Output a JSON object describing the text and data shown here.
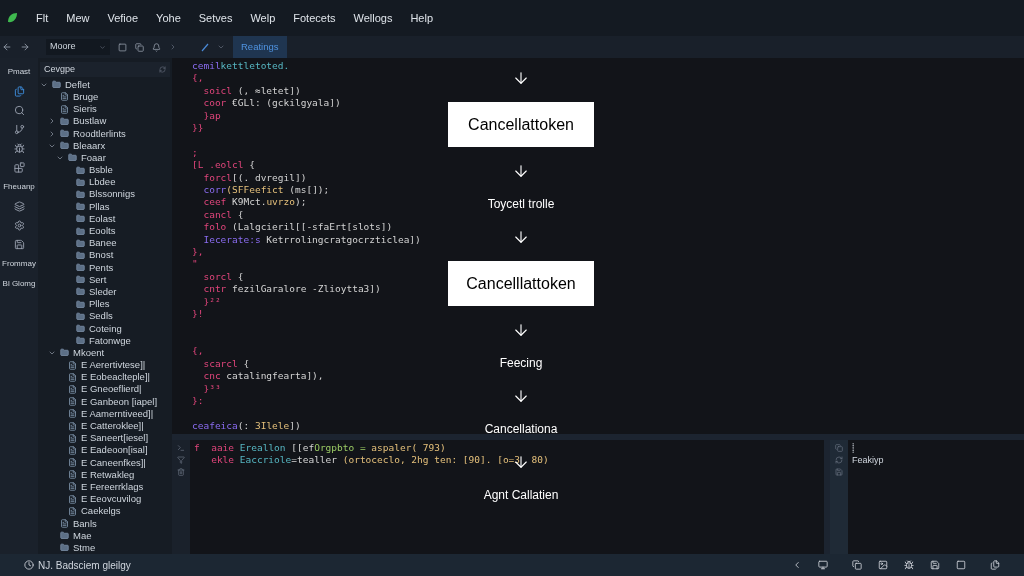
{
  "menu_bar": {
    "items": [
      "Flt",
      "Mew",
      "Vefioe",
      "Yohe",
      "Setves",
      "Welp",
      "Fotecets",
      "Wellogs",
      "Help"
    ]
  },
  "toolbar": {
    "dropdown": "Moore",
    "tabs": [
      {
        "label": "Reatings",
        "selected": true
      }
    ]
  },
  "activity_bar": {
    "labels": [
      "Pmast",
      "Fheuanp",
      "Frommay",
      "Bl Glomg"
    ]
  },
  "sidebar": {
    "header": "Cevgpe",
    "tree": [
      {
        "label": "Deflet",
        "kind": "folder",
        "expanded": true,
        "children": [
          {
            "label": "Bruge",
            "kind": "file"
          },
          {
            "label": "Sieris",
            "kind": "file"
          },
          {
            "label": "Bustlaw",
            "kind": "folder",
            "expanded": false
          },
          {
            "label": "Roodtlerlints",
            "kind": "folder",
            "expanded": false
          },
          {
            "label": "Bleaarx",
            "kind": "folder",
            "expanded": true,
            "children": [
              {
                "label": "Foaar",
                "kind": "folder",
                "expanded": true,
                "children": [
                  {
                    "label": "Bsble",
                    "kind": "folder"
                  },
                  {
                    "label": "Lbdee",
                    "kind": "folder"
                  },
                  {
                    "label": "Blssonnigs",
                    "kind": "folder"
                  },
                  {
                    "label": "Pllas",
                    "kind": "folder"
                  },
                  {
                    "label": "Eolast",
                    "kind": "folder"
                  },
                  {
                    "label": "Eoolts",
                    "kind": "folder"
                  },
                  {
                    "label": "Banee",
                    "kind": "folder"
                  },
                  {
                    "label": "Bnost",
                    "kind": "folder"
                  },
                  {
                    "label": "Pents",
                    "kind": "folder"
                  },
                  {
                    "label": "Sert",
                    "kind": "folder"
                  },
                  {
                    "label": "Sleder",
                    "kind": "folder"
                  },
                  {
                    "label": "Plles",
                    "kind": "folder"
                  },
                  {
                    "label": "Sedls",
                    "kind": "folder"
                  },
                  {
                    "label": "Coteing",
                    "kind": "folder"
                  },
                  {
                    "label": "Fatonwge",
                    "kind": "folder"
                  }
                ]
              }
            ]
          },
          {
            "label": "Mkoent",
            "kind": "folder",
            "expanded": true,
            "children": [
              {
                "label": "E Aerertivtese]|",
                "kind": "file"
              },
              {
                "label": "E Eobeaclteple]|",
                "kind": "file"
              },
              {
                "label": "E Gneoeflierd|",
                "kind": "file"
              },
              {
                "label": "E Ganbeon [iapel]",
                "kind": "file"
              },
              {
                "label": "E Aamerntiveed]|",
                "kind": "file"
              },
              {
                "label": "E Catteroklee]|",
                "kind": "file"
              },
              {
                "label": "E Saneert[iesel]",
                "kind": "file"
              },
              {
                "label": "E Eadeoon[isal]",
                "kind": "file"
              },
              {
                "label": "E Caneenfkes]|",
                "kind": "file"
              },
              {
                "label": "E Retwakleg",
                "kind": "file"
              },
              {
                "label": "E Fereerrklags",
                "kind": "file"
              },
              {
                "label": "E Eeovcuvilog",
                "kind": "file"
              },
              {
                "label": "Caekelgs",
                "kind": "file"
              }
            ]
          },
          {
            "label": "Banls",
            "kind": "file"
          },
          {
            "label": "Mae",
            "kind": "folder"
          },
          {
            "label": "Stme",
            "kind": "folder"
          }
        ]
      }
    ]
  },
  "editor": {
    "lines": [
      {
        "kind": "code",
        "segments": [
          {
            "kind": "type",
            "text": "cemil"
          },
          {
            "kind": "func",
            "text": "kettletoted."
          }
        ]
      },
      {
        "kind": "code",
        "segments": [
          {
            "kind": "keyword",
            "text": "{,"
          }
        ]
      },
      {
        "kind": "code",
        "segments": [
          {
            "kind": "keyword",
            "text": "  soicl"
          },
          {
            "kind": "plain",
            "text": " (, ≈letet])"
          }
        ]
      },
      {
        "kind": "code",
        "segments": [
          {
            "kind": "keyword",
            "text": "  coor"
          },
          {
            "kind": "plain",
            "text": " €GLl: (gckilgyala])"
          }
        ]
      },
      {
        "kind": "code",
        "segments": [
          {
            "kind": "keyword",
            "text": "  }ap"
          }
        ]
      },
      {
        "kind": "code",
        "segments": [
          {
            "kind": "keyword",
            "text": "}}"
          }
        ]
      },
      {
        "kind": "blank"
      },
      {
        "kind": "code",
        "segments": [
          {
            "kind": "keyword",
            "text": ";"
          }
        ]
      },
      {
        "kind": "code",
        "segments": [
          {
            "kind": "keyword",
            "text": "[L .eolcl"
          },
          {
            "kind": "plain",
            "text": " {"
          }
        ]
      },
      {
        "kind": "code",
        "segments": [
          {
            "kind": "keyword",
            "text": "  forcl"
          },
          {
            "kind": "plain",
            "text": "[(. dvregil])"
          }
        ]
      },
      {
        "kind": "code",
        "segments": [
          {
            "kind": "type",
            "text": "  corr"
          },
          {
            "kind": "string",
            "text": "(SFFeefict"
          },
          {
            "kind": "plain",
            "text": " (ms[]);"
          }
        ]
      },
      {
        "kind": "code",
        "segments": [
          {
            "kind": "keyword",
            "text": "  ceef"
          },
          {
            "kind": "plain",
            "text": " K9Mct."
          },
          {
            "kind": "string",
            "text": "uvrzo"
          },
          {
            "kind": "plain",
            "text": ");"
          }
        ]
      },
      {
        "kind": "code",
        "segments": [
          {
            "kind": "keyword",
            "text": "  cancl"
          },
          {
            "kind": "plain",
            "text": " {"
          }
        ]
      },
      {
        "kind": "code",
        "segments": [
          {
            "kind": "keyword",
            "text": "  folo"
          },
          {
            "kind": "plain",
            "text": " (Lalgcieril[[-sfaErt[slots])"
          }
        ]
      },
      {
        "kind": "code",
        "segments": [
          {
            "kind": "type",
            "text": "  Iecerate:s"
          },
          {
            "kind": "plain",
            "text": " Ketrrolingcratgocrzticlea])"
          }
        ]
      },
      {
        "kind": "code",
        "segments": [
          {
            "kind": "keyword",
            "text": "},"
          }
        ]
      },
      {
        "kind": "code",
        "segments": [
          {
            "kind": "keyword",
            "text": "\""
          }
        ]
      },
      {
        "kind": "code",
        "segments": [
          {
            "kind": "keyword",
            "text": "  sorcl"
          },
          {
            "kind": "plain",
            "text": " {"
          }
        ]
      },
      {
        "kind": "code",
        "segments": [
          {
            "kind": "keyword",
            "text": "  cntr"
          },
          {
            "kind": "plain",
            "text": " fezilGaralore -Zlioytta3])"
          }
        ]
      },
      {
        "kind": "code",
        "segments": [
          {
            "kind": "keyword",
            "text": "  }²²"
          }
        ]
      },
      {
        "kind": "code",
        "segments": [
          {
            "kind": "keyword",
            "text": "}!"
          }
        ]
      },
      {
        "kind": "blank"
      },
      {
        "kind": "blank"
      },
      {
        "kind": "code",
        "segments": [
          {
            "kind": "keyword",
            "text": "{,"
          }
        ]
      },
      {
        "kind": "code",
        "segments": [
          {
            "kind": "keyword",
            "text": "  scarcl"
          },
          {
            "kind": "plain",
            "text": " {"
          }
        ]
      },
      {
        "kind": "code",
        "segments": [
          {
            "kind": "keyword",
            "text": "  cnc"
          },
          {
            "kind": "plain",
            "text": " catalingfearta]),"
          }
        ]
      },
      {
        "kind": "code",
        "segments": [
          {
            "kind": "keyword",
            "text": "  }³³"
          }
        ]
      },
      {
        "kind": "code",
        "segments": [
          {
            "kind": "keyword",
            "text": "}:"
          }
        ]
      },
      {
        "kind": "blank"
      },
      {
        "kind": "code",
        "segments": [
          {
            "kind": "type",
            "text": "ceafeica"
          },
          {
            "kind": "plain",
            "text": "(: "
          },
          {
            "kind": "string",
            "text": "3Ilele"
          },
          {
            "kind": "plain",
            "text": "])"
          }
        ]
      }
    ]
  },
  "diagram": {
    "nodes": [
      {
        "kind": "box",
        "text": "Cancellattoken"
      },
      {
        "kind": "label",
        "text": "Toycetl trolle"
      },
      {
        "kind": "box",
        "text": "Cancelllattoken"
      },
      {
        "kind": "label",
        "text": "Feecing"
      },
      {
        "kind": "label",
        "text": "Cancellationa"
      },
      {
        "kind": "label",
        "text": "Agnt Callatien"
      }
    ]
  },
  "output_panel": {
    "lines": [
      {
        "segments": [
          {
            "kind": "keyword",
            "text": "f  "
          },
          {
            "kind": "keyword",
            "text": "aaie"
          },
          {
            "kind": "func",
            "text": " Ereallon"
          },
          {
            "kind": "plain",
            "text": " [[ef"
          },
          {
            "kind": "green",
            "text": "Orgpbto = "
          },
          {
            "kind": "string",
            "text": "aspaler( 793)"
          }
        ]
      },
      {
        "segments": [
          {
            "kind": "keyword",
            "text": "   ekle"
          },
          {
            "kind": "func",
            "text": " Eaccriole"
          },
          {
            "kind": "plain",
            "text": "=tealler "
          },
          {
            "kind": "string",
            "text": "(ortoceclo, 2hg ten: [90]. [o=3  80)"
          }
        ]
      }
    ]
  },
  "side_panel": {
    "lines": [
      "⸽",
      "Feakiyp"
    ]
  },
  "status_bar": {
    "text": "NJ. Badsciem gleilgy"
  }
}
